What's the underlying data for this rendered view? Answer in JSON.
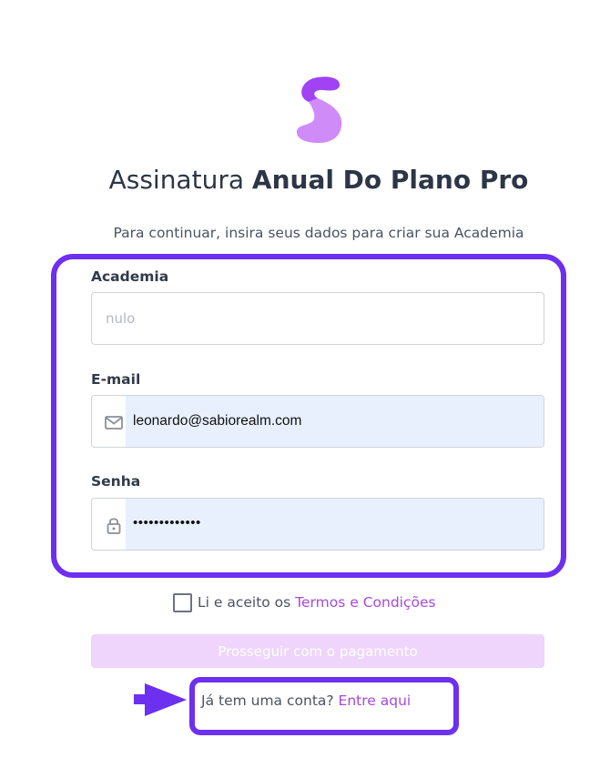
{
  "brand": {
    "logo_icon": "purple-s-logo-icon",
    "colors": {
      "accent": "#6d2ff0",
      "link": "#a64ad8",
      "logo_top": "#a142f4",
      "logo_bottom": "#cf8bf8",
      "button_disabled_bg": "#efd5fb",
      "autofill_bg": "#e8f0fe"
    }
  },
  "header": {
    "title_regular": "Assinatura",
    "title_bold": "Anual Do Plano Pro",
    "subtitle": "Para continuar, insira seus dados para criar sua Academia"
  },
  "form": {
    "academia": {
      "label": "Academia",
      "placeholder": "nulo",
      "value": ""
    },
    "email": {
      "label": "E-mail",
      "value": "leonardo@sabiorealm.com",
      "icon": "envelope-icon"
    },
    "senha": {
      "label": "Senha",
      "value": "•••••••••••••",
      "icon": "lock-icon"
    }
  },
  "terms": {
    "checked": false,
    "prefix": "Li e aceito os ",
    "link": "Termos e Condições"
  },
  "submit": {
    "label": "Prosseguir com o pagamento"
  },
  "login": {
    "prefix": "Já tem uma conta? ",
    "link": "Entre aqui"
  },
  "annotations": {
    "arrow_icon": "arrow-right-icon"
  }
}
